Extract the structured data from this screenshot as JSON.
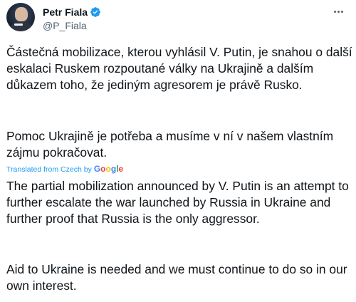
{
  "author": {
    "display_name": "Petr Fiala",
    "handle": "@P_Fiala",
    "verified": true
  },
  "tweet": {
    "original_text": [
      "Částečná mobilizace, kterou vyhlásil V. Putin, je snahou o další eskalaci Ruskem rozpoutané války na Ukrajině a dalším důkazem toho, že jediným agresorem je právě Rusko.",
      "Pomoc Ukrajině je potřeba a musíme v ní v našem vlastním zájmu pokračovat."
    ],
    "translation_label": "Translated from Czech by",
    "translation_provider": [
      "G",
      "o",
      "o",
      "g",
      "l",
      "e"
    ],
    "translated_text": [
      "The partial mobilization announced by V. Putin is an attempt to further escalate the war launched by Russia in Ukraine and further proof that Russia is the only aggressor.",
      "Aid to Ukraine is needed and we must continue to do so in our own interest."
    ]
  },
  "colors": {
    "text": "#0f1419",
    "secondary_text": "#536471",
    "link": "#1d9bf0",
    "verified_badge": "#1d9bf0"
  },
  "icons": {
    "verified": "verified-badge-icon",
    "more": "more-options-icon"
  }
}
